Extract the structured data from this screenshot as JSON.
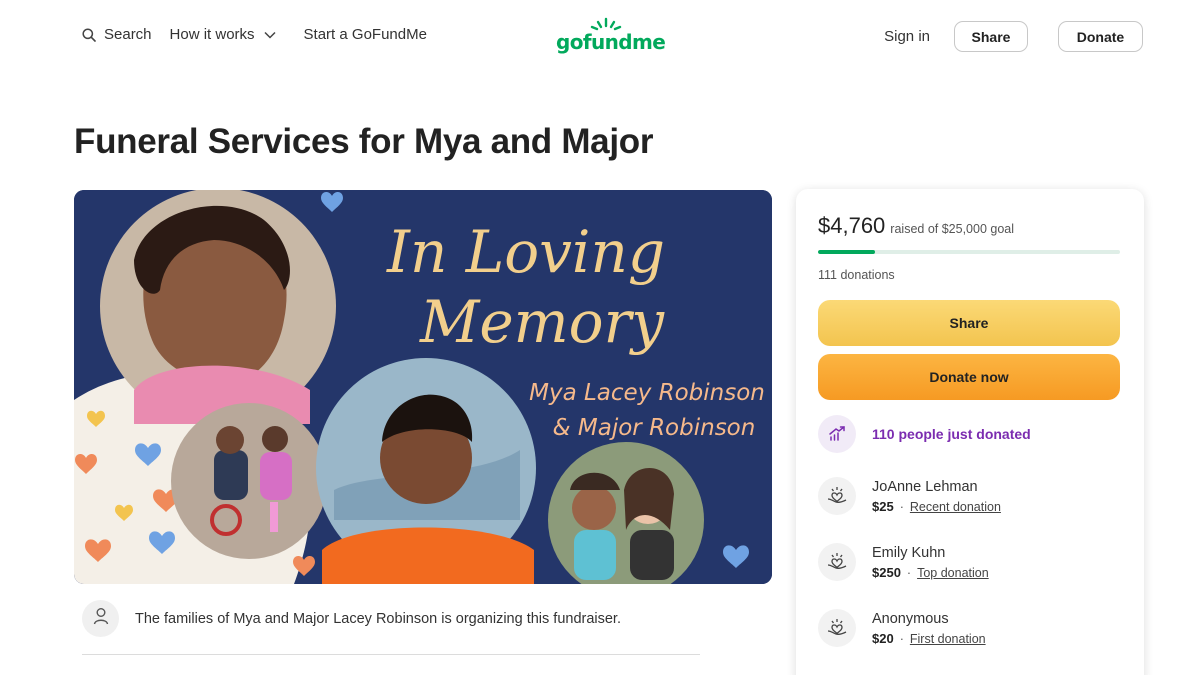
{
  "nav": {
    "search_label": "Search",
    "how_it_works_label": "How it works",
    "start_label": "Start a GoFundMe",
    "logo_text": "gofundme",
    "signin_label": "Sign in",
    "share_label": "Share",
    "donate_label": "Donate"
  },
  "page": {
    "title": "Funeral Services for Mya and Major"
  },
  "hero": {
    "line1": "In Loving",
    "line2": "Memory",
    "line3": "Mya Lacey Robinson",
    "line4": "& Major Robinson"
  },
  "organizer": {
    "text": "The families of Mya and Major Lacey Robinson is organizing this fundraiser."
  },
  "campaign": {
    "raised": "$4,760",
    "goal_text": "raised of $25,000 goal",
    "progress_fraction": 0.19,
    "donations_count": "111 donations",
    "share_button": "Share",
    "donate_button": "Donate now",
    "recent_activity": "110 people just donated",
    "donors": [
      {
        "name": "JoAnne Lehman",
        "amount": "$25",
        "tag": "Recent donation"
      },
      {
        "name": "Emily Kuhn",
        "amount": "$250",
        "tag": "Top donation"
      },
      {
        "name": "Anonymous",
        "amount": "$20",
        "tag": "First donation"
      }
    ]
  },
  "colors": {
    "brand_green": "#02a95c",
    "share_yellow": "#f3c44f",
    "donate_orange": "#f69a23",
    "activity_purple": "#7b2cb0",
    "banner_navy": "#24366a"
  },
  "icons": [
    "search-icon",
    "chevron-down-icon",
    "person-icon",
    "trend-up-icon",
    "heart-hand-icon"
  ]
}
